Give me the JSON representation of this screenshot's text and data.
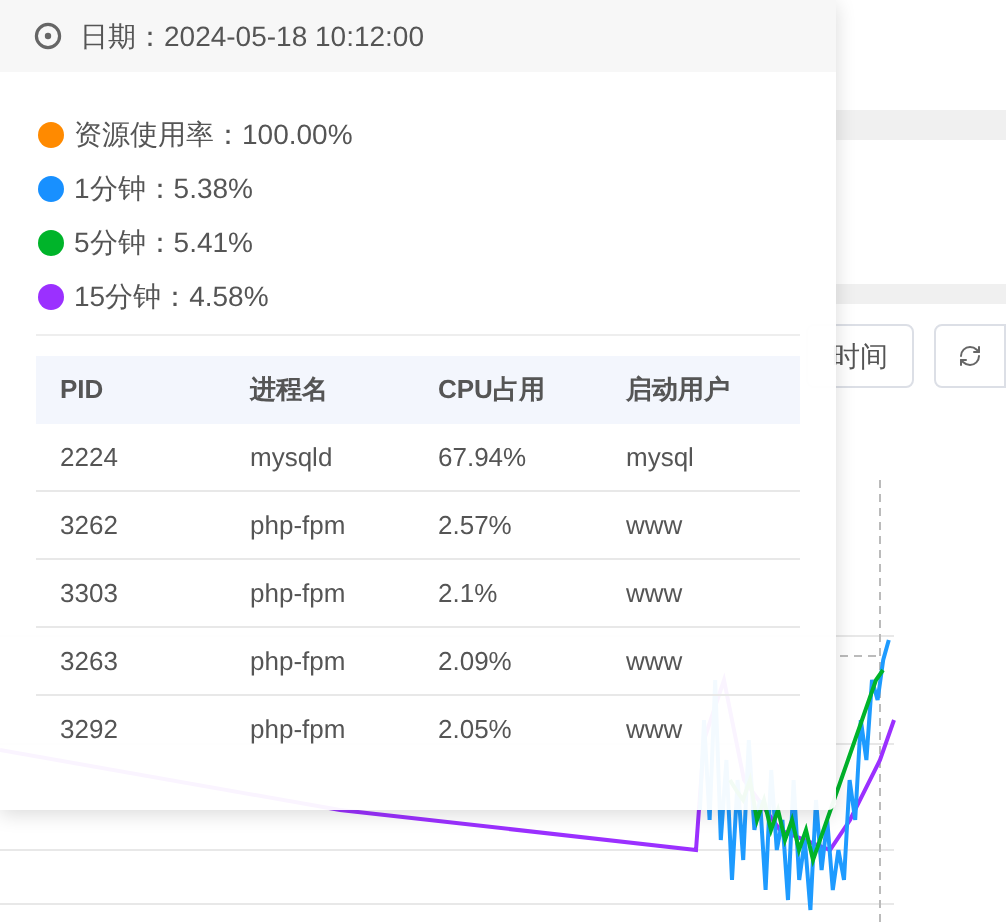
{
  "toolbar": {
    "buttons": [
      {
        "kind": "text",
        "label": "时间"
      },
      {
        "kind": "refresh"
      }
    ]
  },
  "tooltip": {
    "date_label": "日期：2024-05-18 10:12:00",
    "series": [
      {
        "label": "资源使用率：100.00%",
        "color": "#ff8a00"
      },
      {
        "label": "1分钟：5.38%",
        "color": "#1890ff"
      },
      {
        "label": "5分钟：5.41%",
        "color": "#00b42a"
      },
      {
        "label": "15分钟：4.58%",
        "color": "#9b30ff"
      }
    ],
    "table": {
      "columns": [
        "PID",
        "进程名",
        "CPU占用",
        "启动用户"
      ],
      "rows": [
        [
          "2224",
          "mysqld",
          "67.94%",
          "mysql"
        ],
        [
          "3262",
          "php-fpm",
          "2.57%",
          "www"
        ],
        [
          "3303",
          "php-fpm",
          "2.1%",
          "www"
        ],
        [
          "3263",
          "php-fpm",
          "2.09%",
          "www"
        ],
        [
          "3292",
          "php-fpm",
          "2.05%",
          "www"
        ]
      ]
    }
  }
}
